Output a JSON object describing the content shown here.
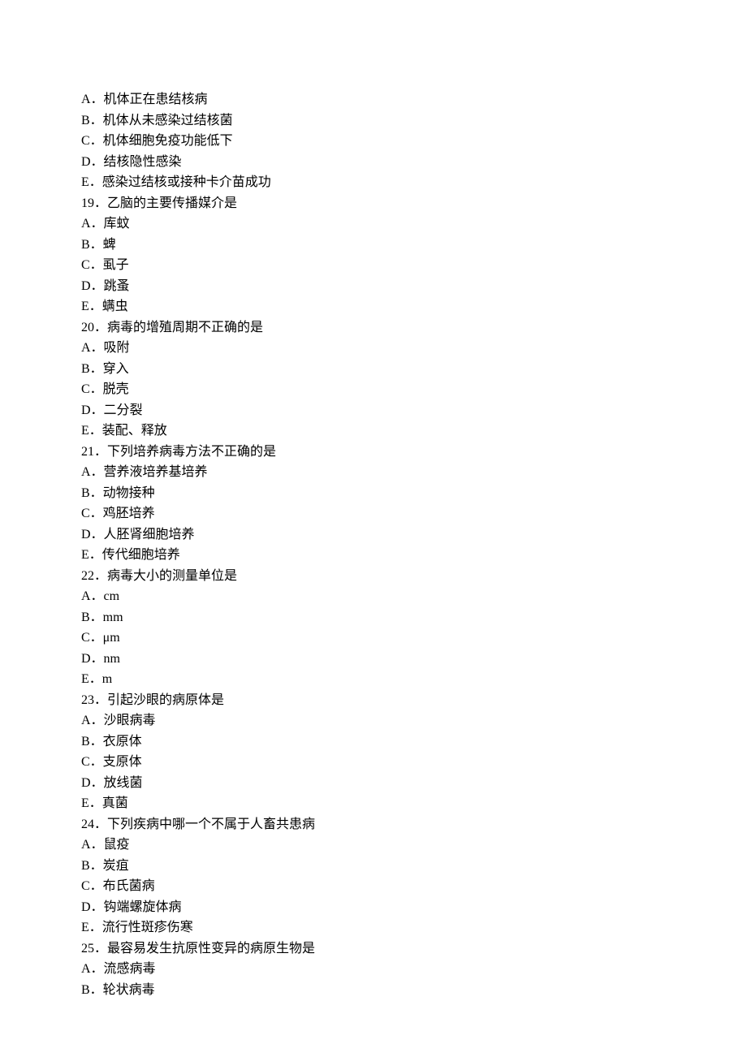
{
  "lines": [
    "A．机体正在患结核病",
    "B．机体从未感染过结核菌",
    "C．机体细胞免疫功能低下",
    "D．结核隐性感染",
    "E．感染过结核或接种卡介苗成功",
    "19．乙脑的主要传播媒介是",
    "A．库蚊",
    "B．蜱",
    "C．虱子",
    "D．跳蚤",
    "E．螨虫",
    "20．病毒的增殖周期不正确的是",
    "A．吸附",
    "B．穿入",
    "C．脱壳",
    "D．二分裂",
    "E．装配、释放",
    "21．下列培养病毒方法不正确的是",
    "A．营养液培养基培养",
    "B．动物接种",
    "C．鸡胚培养",
    "D．人胚肾细胞培养",
    "E．传代细胞培养",
    "22．病毒大小的测量单位是",
    "A．cm",
    "B．mm",
    "C．μm",
    "D．nm",
    "E．m",
    "23．引起沙眼的病原体是",
    "A．沙眼病毒",
    "B．衣原体",
    "C．支原体",
    "D．放线菌",
    "E．真菌",
    "24．下列疾病中哪一个不属于人畜共患病",
    "A．鼠疫",
    "B．炭疽",
    "C．布氏菌病",
    "D．钩端螺旋体病",
    "E．流行性斑疹伤寒",
    "25．最容易发生抗原性变异的病原生物是",
    "A．流感病毒",
    "B．轮状病毒"
  ]
}
